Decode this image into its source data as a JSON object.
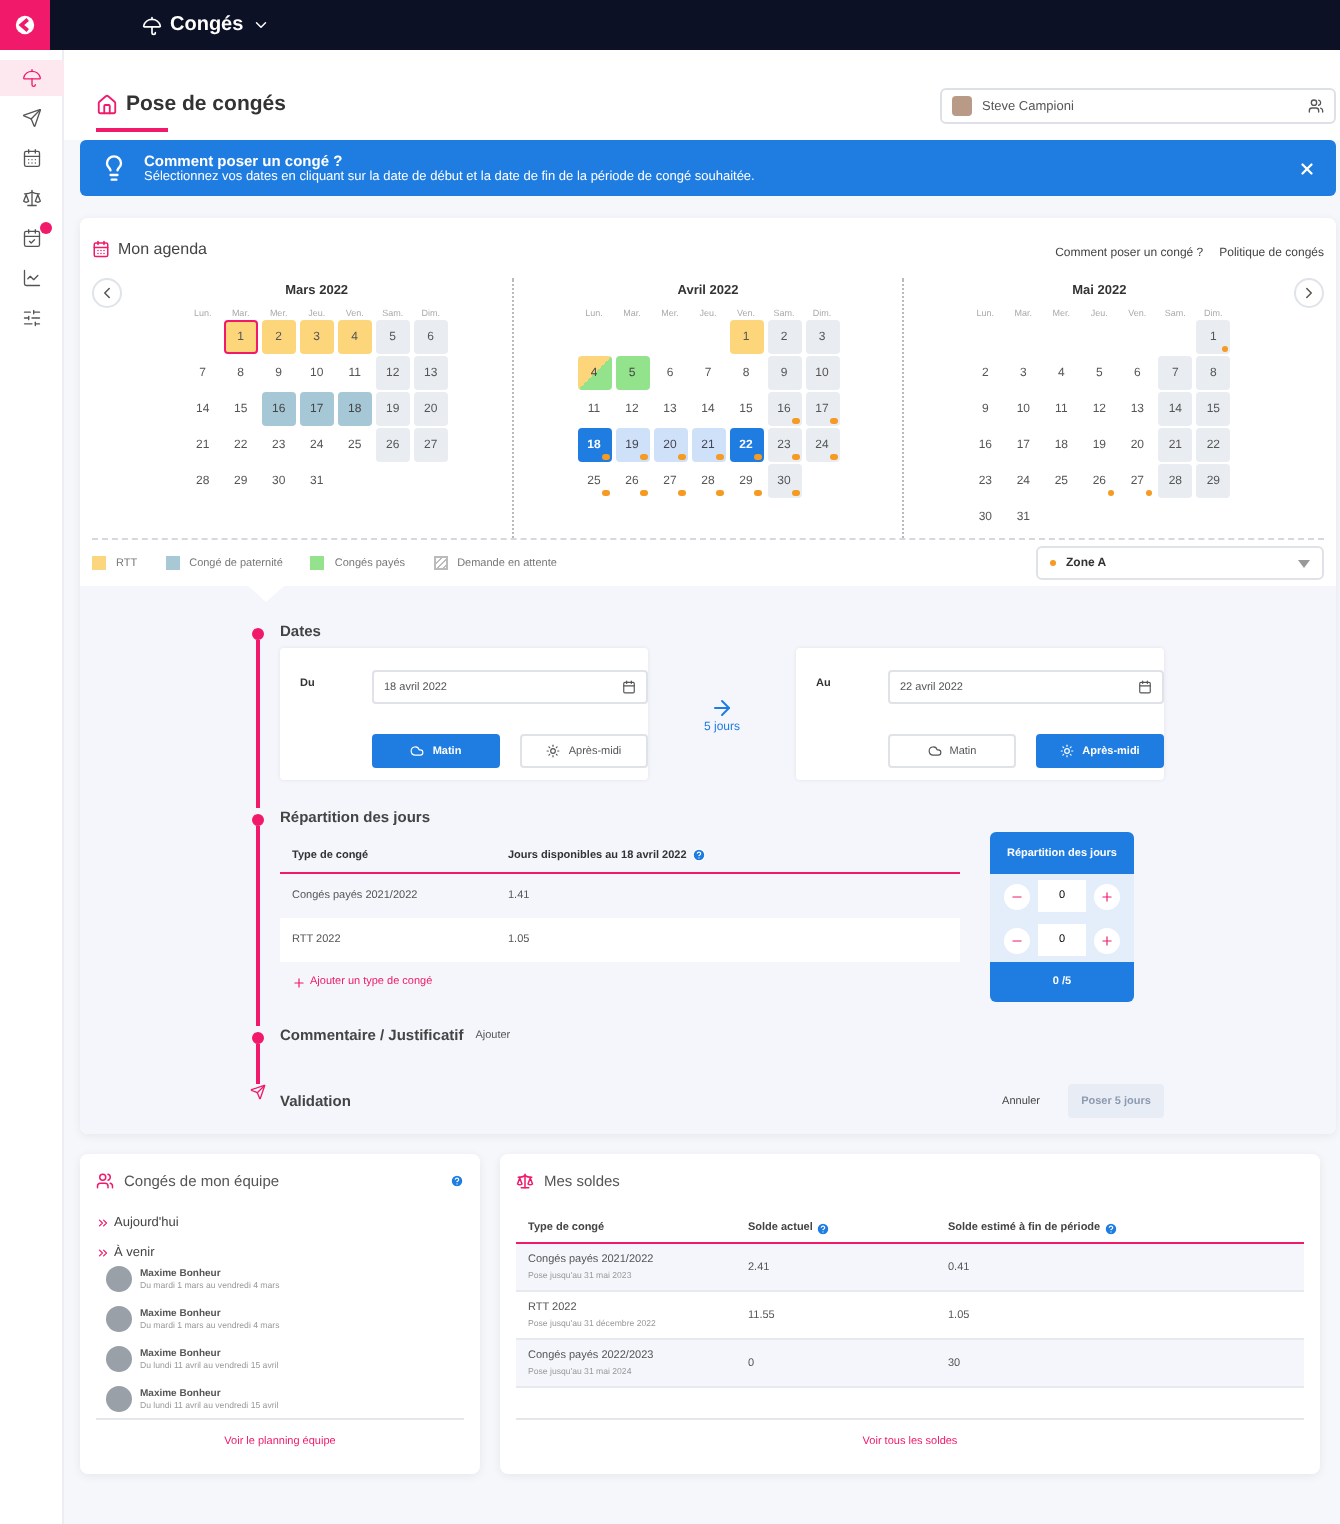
{
  "app": {
    "title": "Congés"
  },
  "sidebar": {
    "items": [
      {
        "selected": true,
        "badge": false
      },
      {
        "selected": false,
        "badge": false
      },
      {
        "selected": false,
        "badge": false
      },
      {
        "selected": false,
        "badge": false
      },
      {
        "selected": false,
        "badge": true
      },
      {
        "selected": false,
        "badge": false
      },
      {
        "selected": false,
        "badge": false
      }
    ]
  },
  "page": {
    "title": "Pose de congés",
    "user": "Steve Campioni"
  },
  "banner": {
    "title": "Comment poser un congé ?",
    "text": "Sélectionnez vos dates en cliquant sur la date de début et la date de fin de la période de congé souhaitée."
  },
  "agenda": {
    "title": "Mon agenda",
    "links": [
      "Comment poser un congé ?",
      "Politique de congés"
    ],
    "months": [
      {
        "name": "Mars 2022",
        "weekdays": [
          "Lun.",
          "Mar.",
          "Mer.",
          "Jeu.",
          "Ven.",
          "Sam.",
          "Dim."
        ],
        "weeks": [
          [
            {
              "d": "1",
              "kind": "rtt",
              "today": true
            },
            {
              "d": "2",
              "kind": "rtt"
            },
            {
              "d": "3",
              "kind": "rtt"
            },
            {
              "d": "4",
              "kind": "rtt"
            },
            {
              "d": "5"
            },
            {
              "d": "6"
            }
          ],
          [
            {
              "d": "7"
            },
            {
              "d": "8"
            },
            {
              "d": "9"
            },
            {
              "d": "10"
            },
            {
              "d": "11"
            },
            {
              "d": "12"
            },
            {
              "d": "13"
            }
          ],
          [
            {
              "d": "14"
            },
            {
              "d": "15"
            },
            {
              "d": "16",
              "kind": "paternity"
            },
            {
              "d": "17",
              "kind": "paternity"
            },
            {
              "d": "18",
              "kind": "paternity"
            },
            {
              "d": "19"
            },
            {
              "d": "20"
            }
          ],
          [
            {
              "d": "21"
            },
            {
              "d": "22"
            },
            {
              "d": "23"
            },
            {
              "d": "24"
            },
            {
              "d": "25"
            },
            {
              "d": "26"
            },
            {
              "d": "27"
            }
          ],
          [
            {
              "d": "28"
            },
            {
              "d": "29"
            },
            {
              "d": "30"
            },
            {
              "d": "31"
            }
          ]
        ]
      },
      {
        "name": "Avril 2022",
        "weekdays": [
          "Lun.",
          "Mar.",
          "Mer.",
          "Jeu.",
          "Ven.",
          "Sam.",
          "Dim."
        ],
        "weeks": [
          [
            {
              "d": "1",
              "kind": "rtt"
            },
            {
              "d": "2"
            },
            {
              "d": "3"
            }
          ],
          [
            {
              "d": "4",
              "kind": "rtt_paid"
            },
            {
              "d": "5",
              "kind": "paid"
            },
            {
              "d": "6"
            },
            {
              "d": "7"
            },
            {
              "d": "8"
            },
            {
              "d": "9"
            },
            {
              "d": "10"
            }
          ],
          [
            {
              "d": "11"
            },
            {
              "d": "12"
            },
            {
              "d": "13"
            },
            {
              "d": "14"
            },
            {
              "d": "15"
            },
            {
              "d": "16",
              "dot": true
            },
            {
              "d": "17",
              "dot": true
            }
          ],
          [
            {
              "d": "18",
              "kind": "edge",
              "dot": true
            },
            {
              "d": "19",
              "kind": "range",
              "dot": true
            },
            {
              "d": "20",
              "kind": "range",
              "dot": true
            },
            {
              "d": "21",
              "kind": "range",
              "dot": true
            },
            {
              "d": "22",
              "kind": "edge",
              "dot": true
            },
            {
              "d": "23",
              "dot": true
            },
            {
              "d": "24",
              "dot": true
            }
          ],
          [
            {
              "d": "25",
              "dot": true
            },
            {
              "d": "26",
              "dot": true
            },
            {
              "d": "27",
              "dot": true
            },
            {
              "d": "28",
              "dot": true
            },
            {
              "d": "29",
              "dot": true
            },
            {
              "d": "30",
              "dot": true
            }
          ]
        ]
      },
      {
        "name": "Mai 2022",
        "weekdays": [
          "Lun.",
          "Mar.",
          "Mer.",
          "Jeu.",
          "Ven.",
          "Sam.",
          "Dim."
        ],
        "weeks": [
          [
            {
              "d": "1",
              "dot": true
            }
          ],
          [
            {
              "d": "2"
            },
            {
              "d": "3"
            },
            {
              "d": "4"
            },
            {
              "d": "5"
            },
            {
              "d": "6"
            },
            {
              "d": "7"
            },
            {
              "d": "8"
            }
          ],
          [
            {
              "d": "9"
            },
            {
              "d": "10"
            },
            {
              "d": "11"
            },
            {
              "d": "12"
            },
            {
              "d": "13"
            },
            {
              "d": "14"
            },
            {
              "d": "15"
            }
          ],
          [
            {
              "d": "16"
            },
            {
              "d": "17"
            },
            {
              "d": "18"
            },
            {
              "d": "19"
            },
            {
              "d": "20"
            },
            {
              "d": "21"
            },
            {
              "d": "22"
            }
          ],
          [
            {
              "d": "23"
            },
            {
              "d": "24"
            },
            {
              "d": "25"
            },
            {
              "d": "26",
              "dot": true
            },
            {
              "d": "27",
              "dot": true
            },
            {
              "d": "28"
            },
            {
              "d": "29"
            }
          ],
          [
            {
              "d": "30"
            },
            {
              "d": "31"
            }
          ]
        ]
      }
    ]
  },
  "legend": [
    {
      "label": "RTT",
      "kind": "swatch",
      "color": "#fcd67e"
    },
    {
      "label": "Congé de paternité",
      "kind": "swatch",
      "color": "#a8c8d6"
    },
    {
      "label": "Congés payés",
      "kind": "swatch",
      "color": "#94e28d"
    },
    {
      "label": "Demande en attente",
      "kind": "hatched"
    }
  ],
  "zone": {
    "value": "Zone A"
  },
  "dates": {
    "title": "Dates",
    "duration": "5 jours",
    "ends": [
      {
        "label": "Du",
        "value": "18 avril 2022",
        "options": [
          {
            "label": "Matin",
            "selected": true
          },
          {
            "label": "Après-midi",
            "selected": false
          }
        ]
      },
      {
        "label": "Au",
        "value": "22 avril 2022",
        "options": [
          {
            "label": "Matin",
            "selected": false
          },
          {
            "label": "Après-midi",
            "selected": true
          }
        ]
      }
    ]
  },
  "split": {
    "title": "Répartition des jours",
    "columns": [
      "Type de congé",
      "Jours disponibles au 18 avril 2022"
    ],
    "panel_title": "Répartition des jours",
    "rows": [
      {
        "type": "Congés payés 2021/2022",
        "available": "1.41",
        "value": "0"
      },
      {
        "type": "RTT 2022",
        "available": "1.05",
        "value": "0"
      }
    ],
    "add": "Ajouter un type de congé",
    "total": "0 /5"
  },
  "comment": {
    "title": "Commentaire / Justificatif",
    "action": "Ajouter"
  },
  "validation": {
    "title": "Validation",
    "cancel": "Annuler",
    "submit": {
      "label": "Poser 5 jours",
      "disabled": true
    }
  },
  "team": {
    "title": "Congés de mon équipe",
    "today": "Aujourd'hui",
    "upcoming": "À venir",
    "people": [
      {
        "name": "Maxime Bonheur",
        "period": "Du mardi 1 mars au vendredi 4 mars"
      },
      {
        "name": "Maxime Bonheur",
        "period": "Du mardi 1 mars au vendredi 4 mars"
      },
      {
        "name": "Maxime Bonheur",
        "period": "Du lundi 11 avril au vendredi 15 avril"
      },
      {
        "name": "Maxime Bonheur",
        "period": "Du lundi 11 avril au vendredi 15 avril"
      }
    ],
    "link": "Voir le planning équipe"
  },
  "balances": {
    "title": "Mes soldes",
    "columns": [
      "Type de congé",
      "Solde actuel",
      "Solde estimé à fin de période"
    ],
    "rows": [
      {
        "type": "Congés payés 2021/2022",
        "note": "Pose jusqu'au 31 mai 2023",
        "current": "2.41",
        "estimated": "0.41"
      },
      {
        "type": "RTT 2022",
        "note": "Pose jusqu'au 31 décembre 2022",
        "current": "11.55",
        "estimated": "1.05"
      },
      {
        "type": "Congés payés 2022/2023",
        "note": "Pose jusqu'au 31 mai 2024",
        "current": "0",
        "estimated": "30"
      }
    ],
    "link": "Voir tous les soldes"
  }
}
